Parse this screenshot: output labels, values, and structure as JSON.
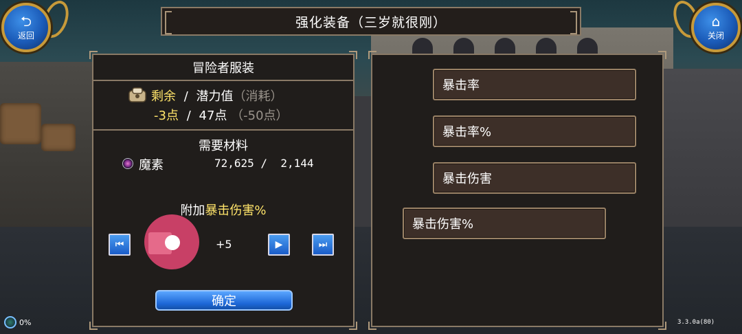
{
  "title": "强化装备（三岁就很刚）",
  "nav": {
    "back_icon": "back-arrow-icon",
    "back_label": "返回",
    "close_icon": "home-icon",
    "close_label": "关闭"
  },
  "left_panel": {
    "header": "冒险者服装",
    "points": {
      "remaining_label": "剩余",
      "sep1": "/",
      "potential_label": "潜力值",
      "consume_label": "（消耗）",
      "remaining_value": "-3点",
      "sep2": "/",
      "potential_value": "47点",
      "consume_value": "（-50点）"
    },
    "materials": {
      "title": "需要材料",
      "item_name": "魔素",
      "item_values": "72,625 /  2,144"
    },
    "attach": {
      "prefix": "附加",
      "attribute": "暴击伤害%"
    },
    "stepper": {
      "value": "+5",
      "first_icon": "skip-to-start-icon",
      "next_icon": "play-next-icon",
      "last_icon": "skip-to-end-icon"
    },
    "confirm_label": "确定"
  },
  "options": [
    "暴击率",
    "暴击率%",
    "暴击伤害",
    "暴击伤害%"
  ],
  "footer": {
    "percent": "0%",
    "version": "3.3.0a(80)"
  },
  "colors": {
    "highlight_yellow": "#ffe46a",
    "panel_bg": "#201d1b",
    "border_gold": "#8a7a66",
    "button_blue": "#1c66d6",
    "touch_indicator": "#d2426a"
  }
}
